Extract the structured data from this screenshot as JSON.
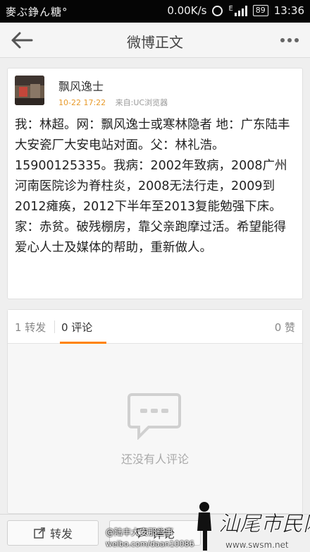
{
  "status_bar": {
    "carrier": "麥ぶ錚ん糖°",
    "speed": "0.00K/s",
    "network": "E",
    "battery": "89",
    "time": "13:36"
  },
  "header": {
    "title": "微博正文"
  },
  "post": {
    "username": "飘风逸士",
    "time": "10-22 17:22",
    "source": "来自:UC浏览器",
    "text": "我：林超。网：飘风逸士或寒林隐者 地：广东陆丰大安瓷厂大安电站对面。父：林礼浩。15900125335。我病：2002年致病，2008广州河南医院诊为脊柱炎，2008无法行走，2009到2012瘫痪，2012下半年至2013复能勉强下床。家：赤贫。破残棚房，靠父亲跑摩过活。希望能得爱心人士及媒体的帮助，重新做人。"
  },
  "tabs": {
    "reposts": "1 转发",
    "comments": "0 评论",
    "likes": "0 赞"
  },
  "comments": {
    "empty_text": "还没有人评论"
  },
  "bottom_bar": {
    "repost_label": "转发",
    "comment_label": "评论"
  },
  "watermark": {
    "weibo_user": "@陆丰大安那些事",
    "weibo_url": "weibo.com/daan10086",
    "site_name": "汕尾市民网",
    "site_url": "www.swsm.net"
  },
  "colors": {
    "accent": "#ff8200",
    "time": "#e89a2a"
  }
}
